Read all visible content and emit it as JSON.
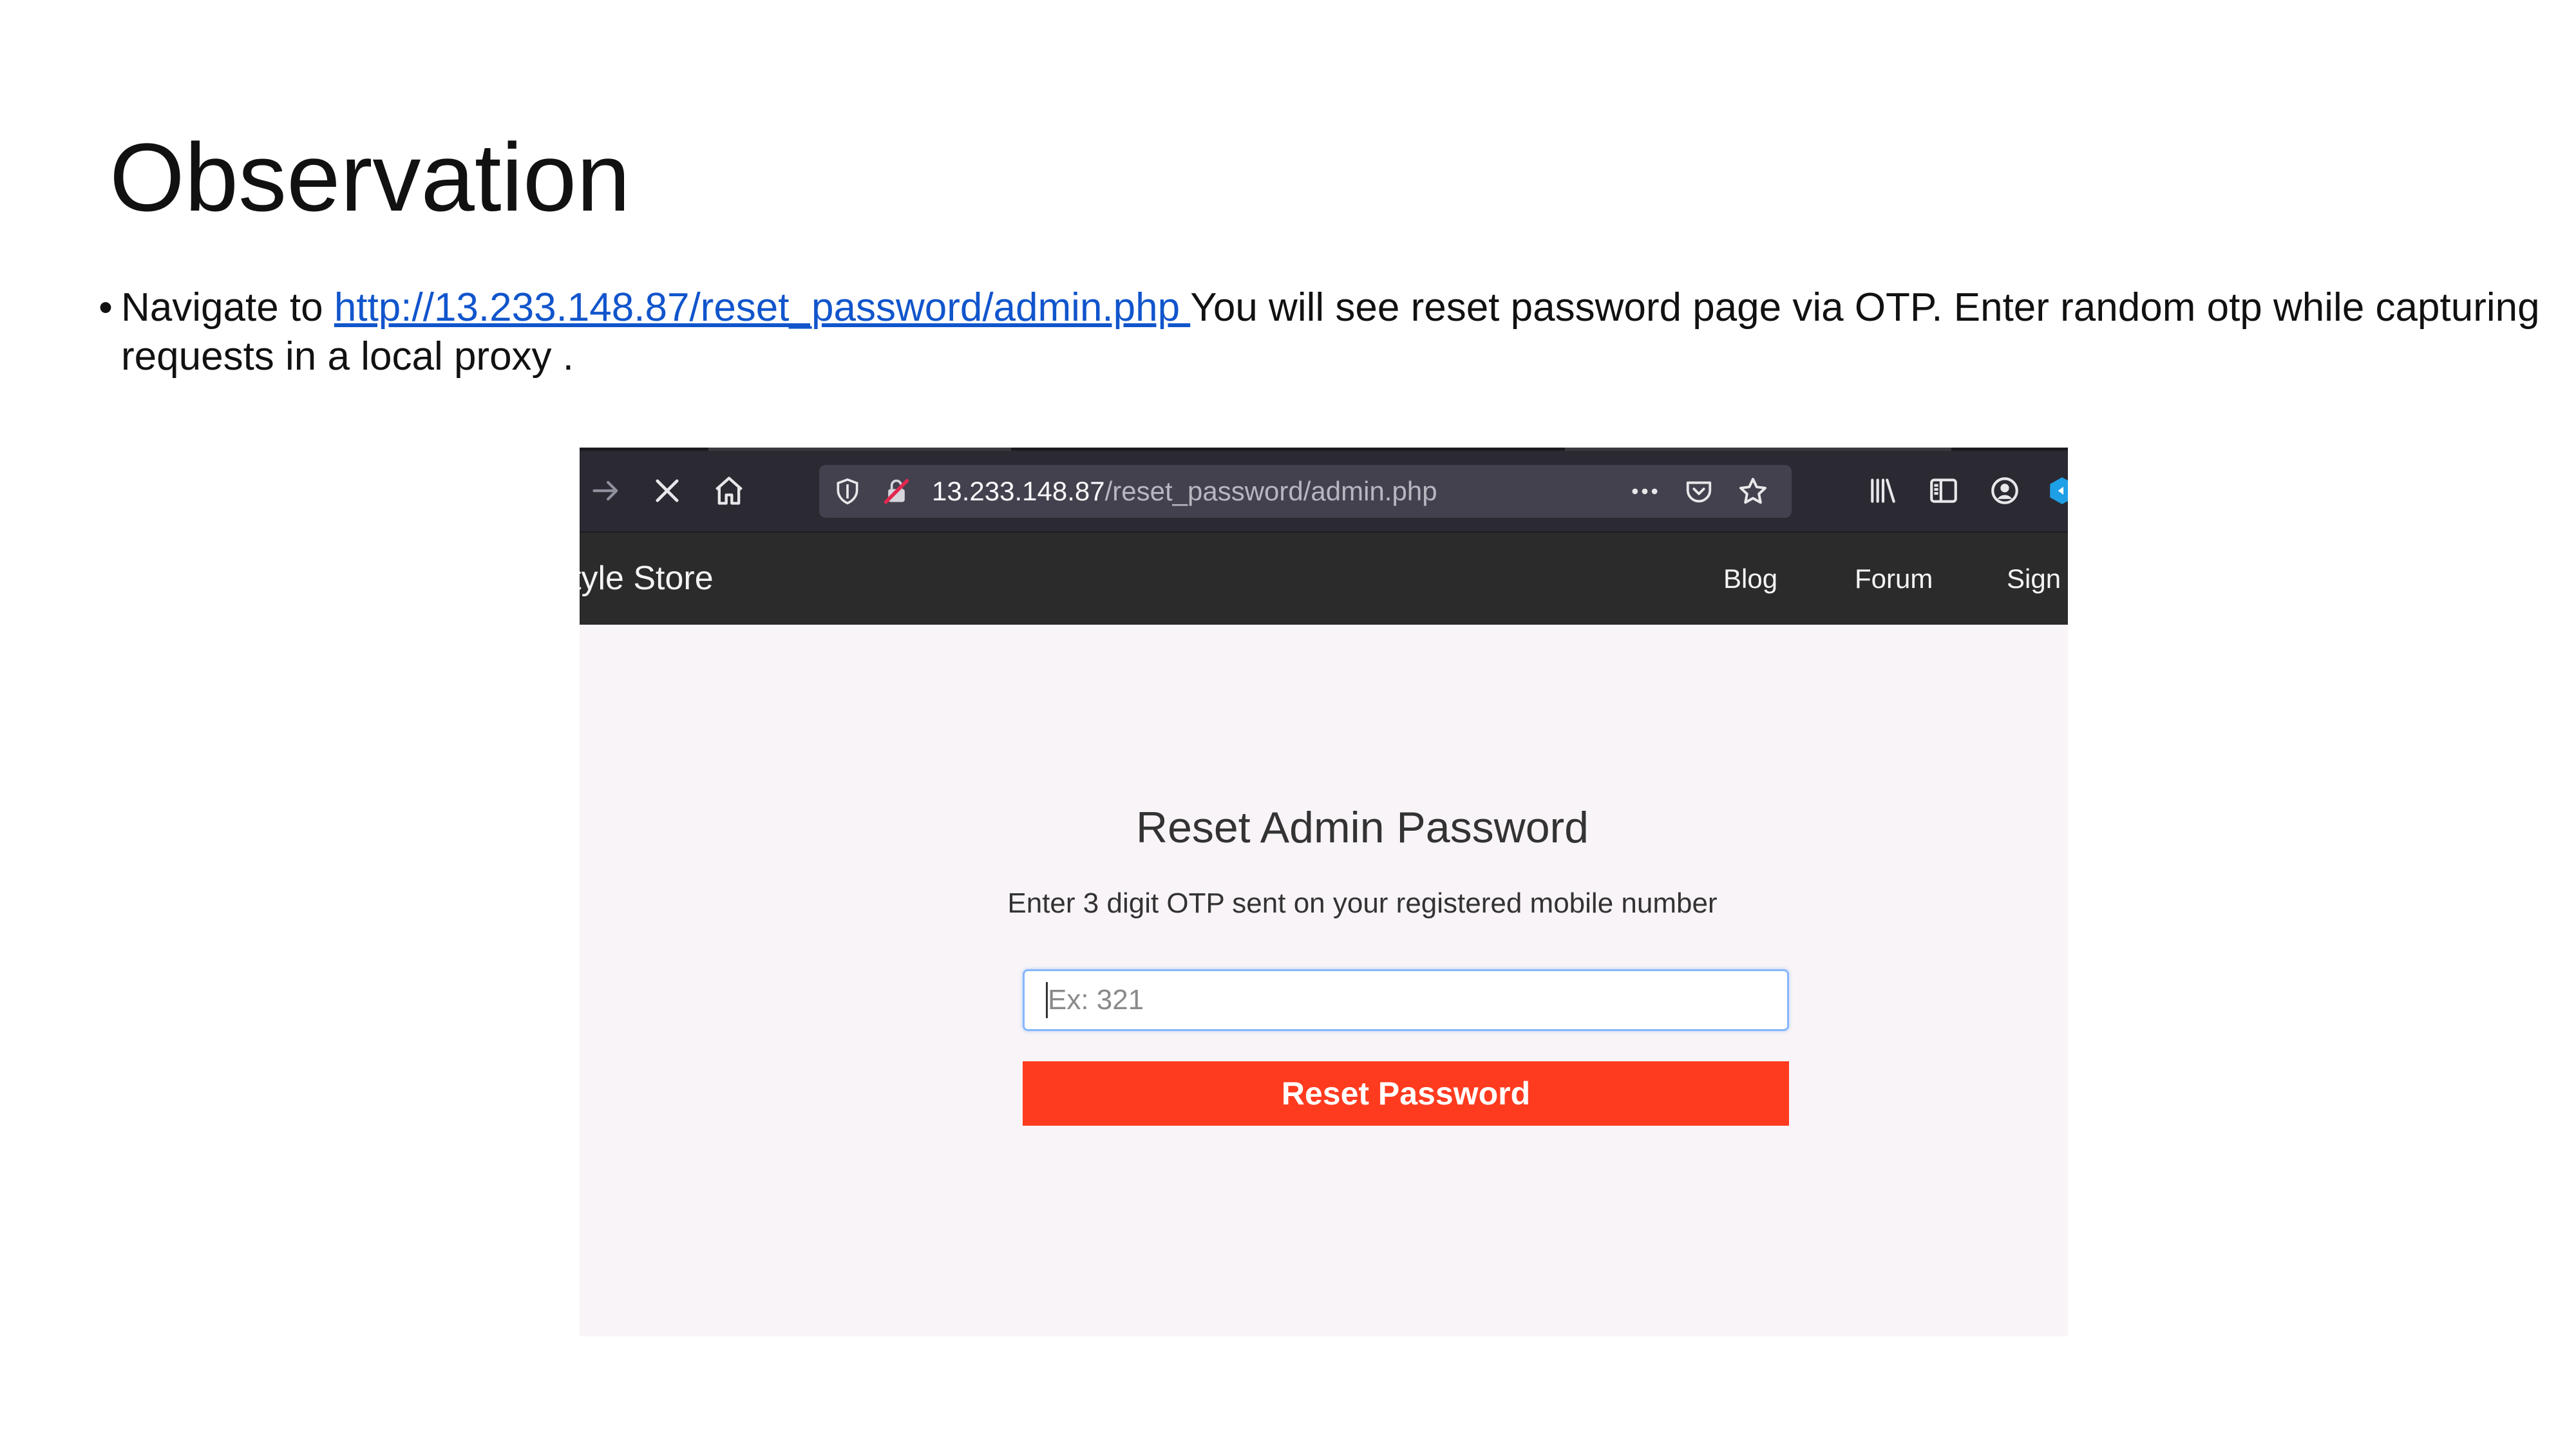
{
  "slide": {
    "title": "Observation",
    "bullet": {
      "prefix": "Navigate to ",
      "link_text": "http://13.233.148.87/reset_password/admin.php ",
      "suffix": " You will see reset password page via OTP. Enter random otp  while capturing requests in a local proxy ."
    }
  },
  "browser": {
    "url_host": "13.233.148.87",
    "url_path": "/reset_password/admin.php",
    "icons": {
      "forward": "forward-arrow-icon",
      "stop": "close-icon",
      "home": "home-icon",
      "shield": "shield-icon",
      "insecure": "insecure-lock-icon",
      "more": "more-dots-icon",
      "pocket": "pocket-icon",
      "bookmark": "star-icon",
      "library": "library-icon",
      "sidebar": "sidebar-icon",
      "account": "account-icon",
      "extension": "extension-icon"
    }
  },
  "site": {
    "brand": "tyle Store",
    "nav": [
      "Blog",
      "Forum",
      "Sign U"
    ]
  },
  "form": {
    "heading": "Reset Admin Password",
    "subtext": "Enter 3 digit OTP sent on your registered mobile number",
    "otp_placeholder": "Ex: 321",
    "button_label": "Reset Password"
  },
  "colors": {
    "accent_button": "#ff3b1f",
    "link": "#1155cc",
    "toolbar": "#2b2a33",
    "site_nav": "#2b2b2b"
  }
}
